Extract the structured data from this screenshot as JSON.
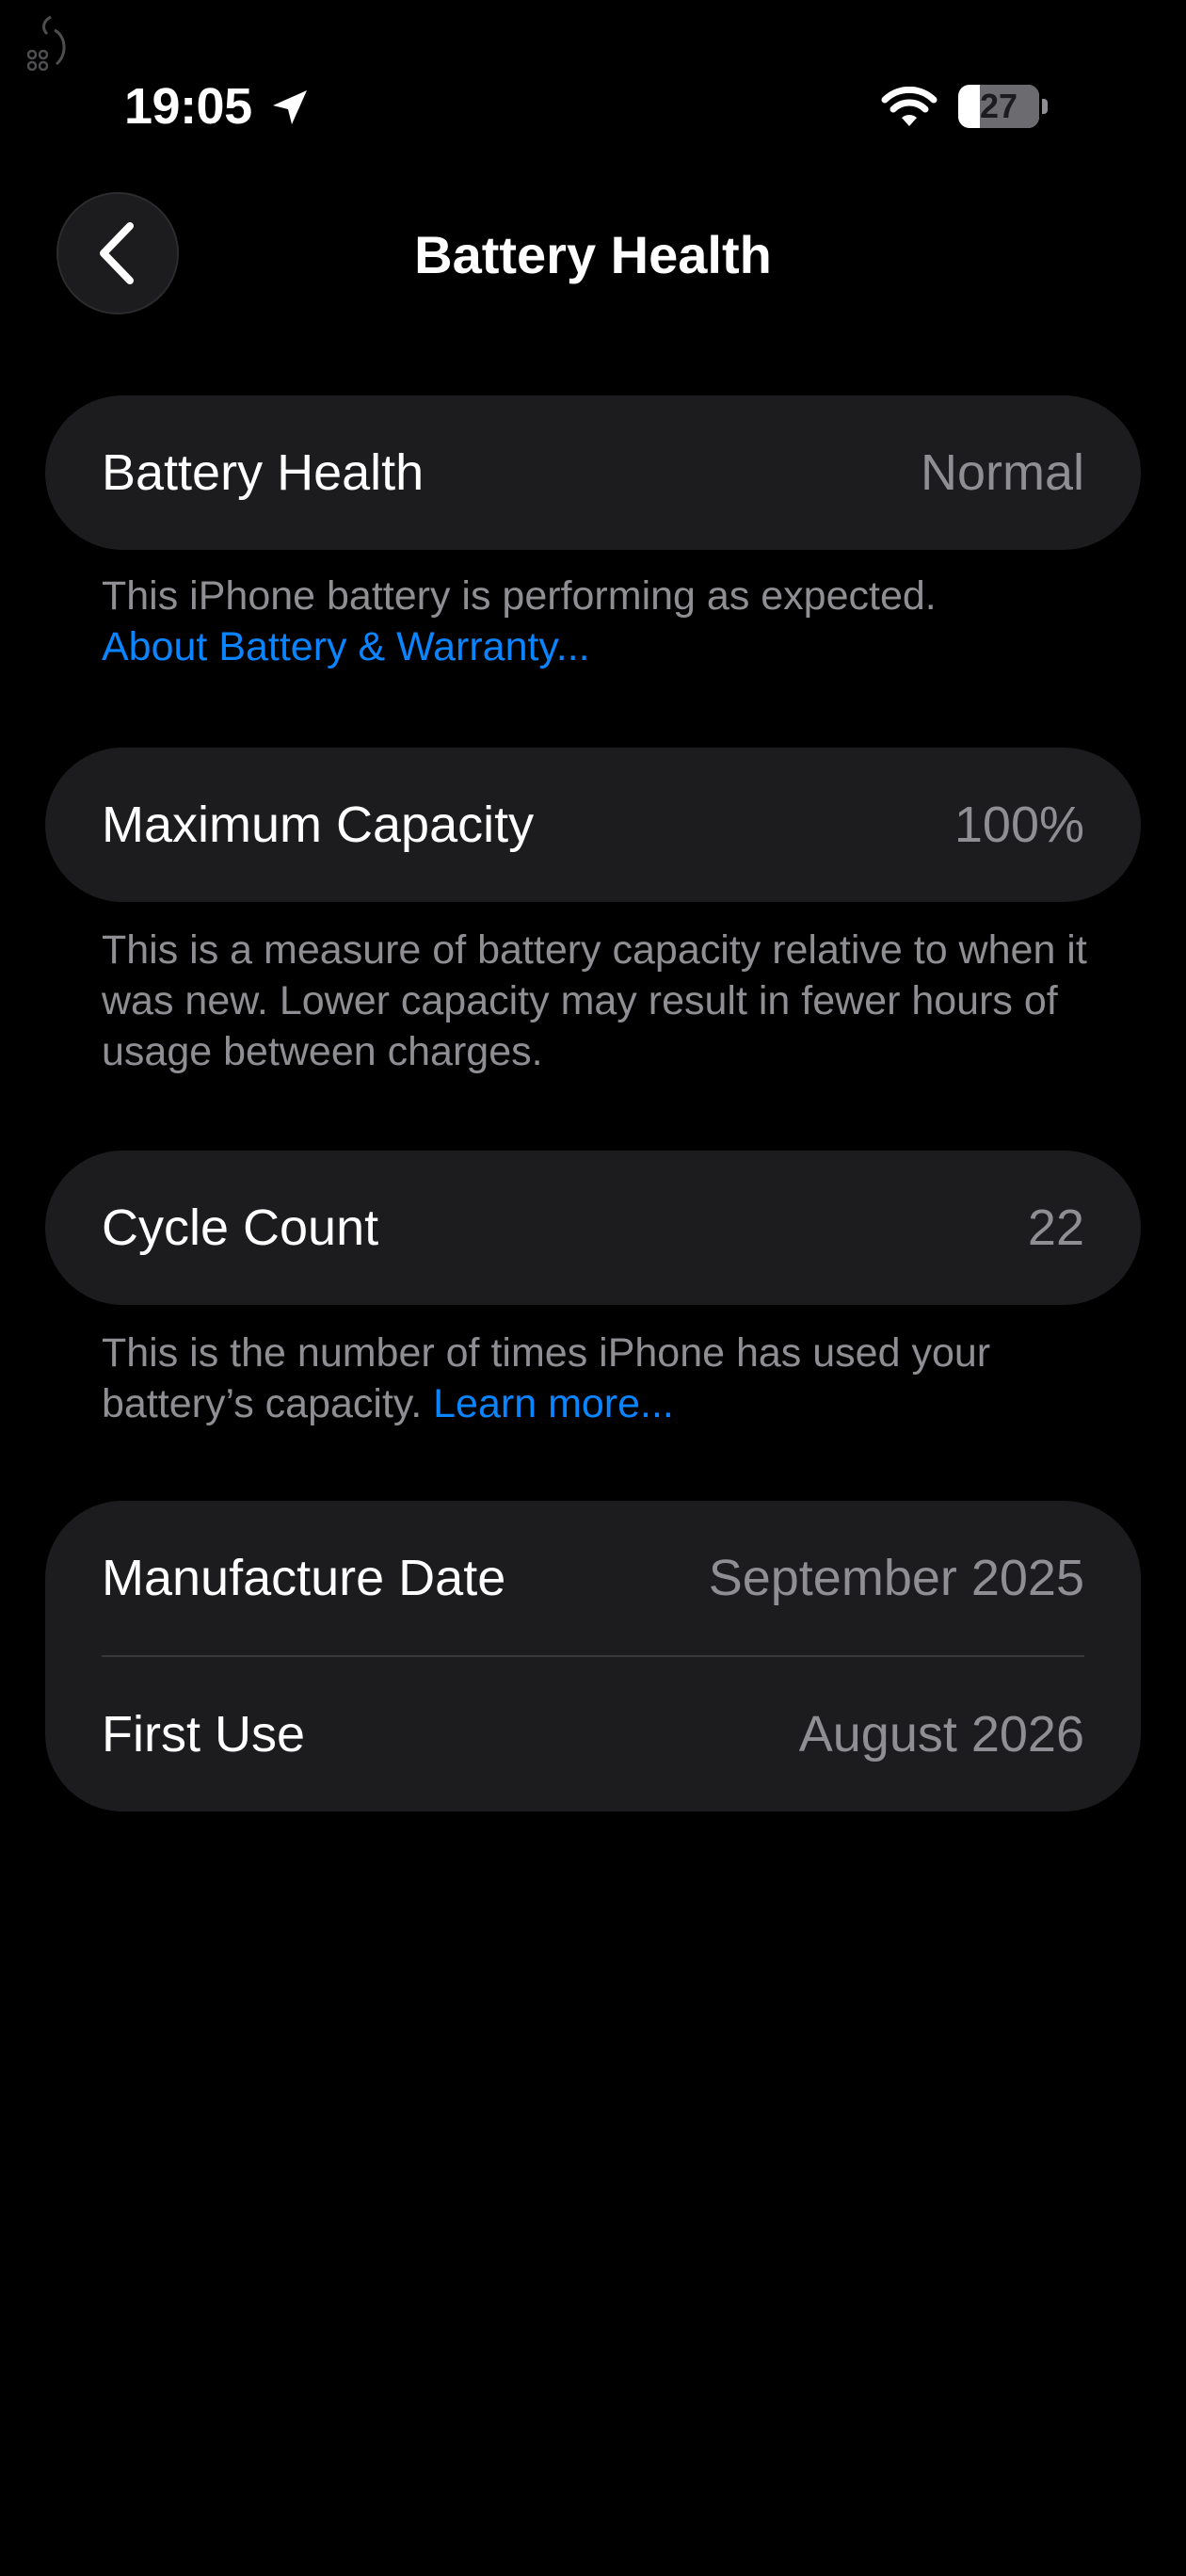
{
  "status_bar": {
    "time": "19:05",
    "battery_level": "27",
    "battery_fraction": 0.27
  },
  "nav": {
    "title": "Battery Health"
  },
  "sections": {
    "health": {
      "label": "Battery Health",
      "value": "Normal",
      "footer_text": "This iPhone battery is performing as expected.",
      "footer_link": "About Battery & Warranty..."
    },
    "capacity": {
      "label": "Maximum Capacity",
      "value": "100%",
      "footer_text": "This is a measure of battery capacity relative to when it was new. Lower capacity may result in fewer hours of usage between charges."
    },
    "cycles": {
      "label": "Cycle Count",
      "value": "22",
      "footer_text": "This is the number of times iPhone has used your battery’s capacity.",
      "footer_link": "Learn more..."
    },
    "dates": {
      "manufacture_label": "Manufacture Date",
      "manufacture_value": "September 2025",
      "first_use_label": "First Use",
      "first_use_value": "August 2026"
    }
  },
  "colors": {
    "background": "#000000",
    "card": "#1c1c1e",
    "secondary_text": "#8e8e93",
    "link": "#0a84ff"
  },
  "icons": [
    "debug-icon",
    "location-arrow-icon",
    "wifi-icon",
    "battery-icon",
    "chevron-left-icon"
  ]
}
